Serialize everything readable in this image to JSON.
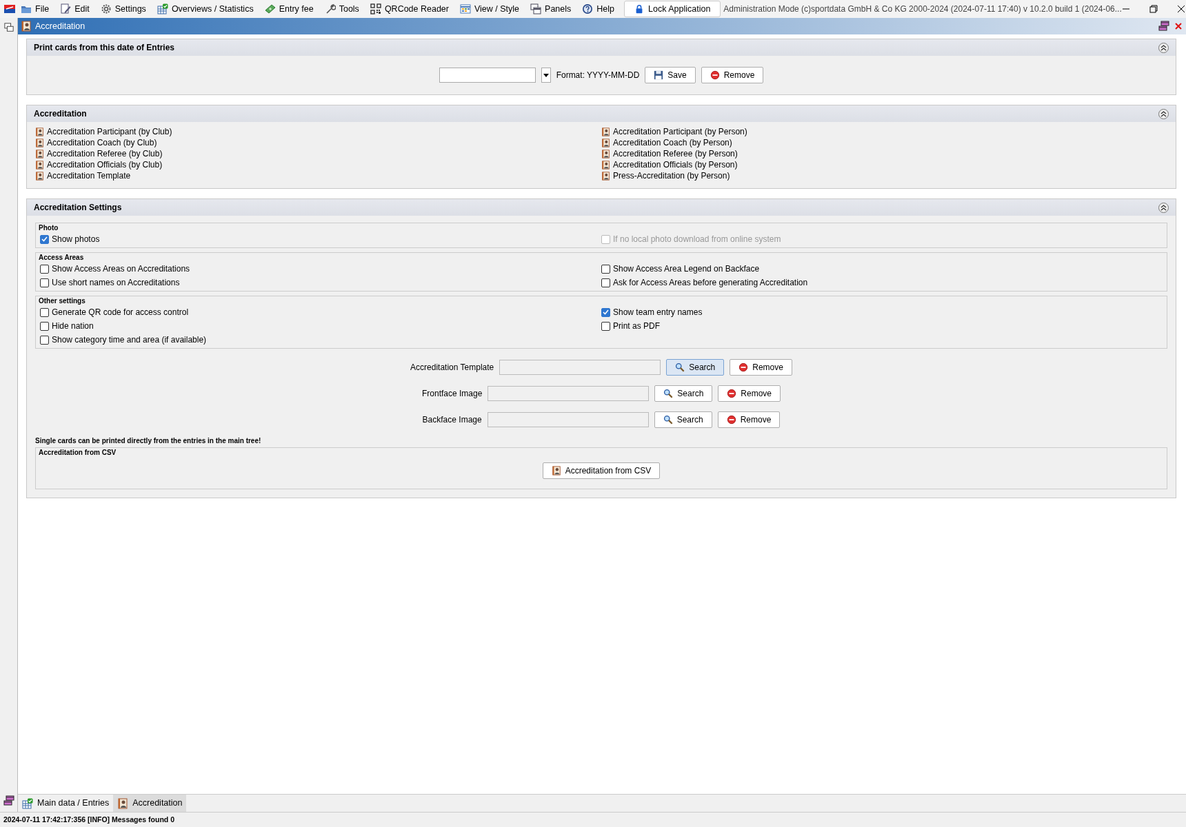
{
  "menu": {
    "items": [
      {
        "label": "File"
      },
      {
        "label": "Edit"
      },
      {
        "label": "Settings"
      },
      {
        "label": "Overviews / Statistics"
      },
      {
        "label": "Entry fee"
      },
      {
        "label": "Tools"
      },
      {
        "label": "QRCode Reader"
      },
      {
        "label": "View / Style"
      },
      {
        "label": "Panels"
      },
      {
        "label": "Help"
      }
    ],
    "lock_button": "Lock Application",
    "app_title": "Administration Mode (c)sportdata GmbH & Co KG 2000-2024 (2024-07-11 17:40)  v 10.2.0 build 1 (2024-06..."
  },
  "document": {
    "title": "Accreditation"
  },
  "print_section": {
    "title": "Print cards from this date of Entries",
    "format_label": "Format: YYYY-MM-DD",
    "save_button": "Save",
    "remove_button": "Remove"
  },
  "accreditation_section": {
    "title": "Accreditation",
    "left_links": [
      "Accreditation Participant (by Club)",
      "Accreditation Coach (by Club)",
      "Accreditation Referee (by Club)",
      "Accreditation Officials (by Club)",
      "Accreditation Template"
    ],
    "right_links": [
      "Accreditation Participant (by Person)",
      "Accreditation Coach (by Person)",
      "Accreditation Referee (by Person)",
      "Accreditation Officials (by Person)",
      "Press-Accreditation (by Person)"
    ]
  },
  "settings_section": {
    "title": "Accreditation Settings",
    "groups": [
      {
        "title": "Photo",
        "left": [
          {
            "label": "Show photos",
            "checked": true,
            "disabled": false
          }
        ],
        "right": [
          {
            "label": "If no local photo download from online system",
            "checked": false,
            "disabled": true
          }
        ]
      },
      {
        "title": "Access Areas",
        "left": [
          {
            "label": "Show Access Areas on Accreditations",
            "checked": false,
            "disabled": false
          },
          {
            "label": "Use short names on Accreditations",
            "checked": false,
            "disabled": false
          }
        ],
        "right": [
          {
            "label": "Show Access Area Legend on Backface",
            "checked": false,
            "disabled": false
          },
          {
            "label": "Ask for Access Areas before generating Accreditation",
            "checked": false,
            "disabled": false
          }
        ]
      },
      {
        "title": "Other settings",
        "left": [
          {
            "label": "Generate QR code for access control",
            "checked": false,
            "disabled": false
          },
          {
            "label": "Hide nation",
            "checked": false,
            "disabled": false
          },
          {
            "label": "Show category time and area (if available)",
            "checked": false,
            "disabled": false
          }
        ],
        "right": [
          {
            "label": "Show team entry names",
            "checked": true,
            "disabled": false
          },
          {
            "label": "Print as PDF",
            "checked": false,
            "disabled": false
          }
        ]
      }
    ],
    "file_rows": [
      {
        "label": "Accreditation Template",
        "search": "Search",
        "remove": "Remove",
        "highlighted": true
      },
      {
        "label": "Frontface Image",
        "search": "Search",
        "remove": "Remove",
        "highlighted": false
      },
      {
        "label": "Backface Image",
        "search": "Search",
        "remove": "Remove",
        "highlighted": false
      }
    ],
    "note": "Single cards can be printed directly from the entries in the main tree!",
    "csv_group": {
      "title": "Accreditation from CSV",
      "button": "Accreditation from CSV"
    }
  },
  "bottom_tabs": [
    {
      "label": "Main data / Entries",
      "selected": false
    },
    {
      "label": "Accreditation",
      "selected": true
    }
  ],
  "status_bar": "2024-07-11 17:42:17:356 [INFO] Messages found 0"
}
